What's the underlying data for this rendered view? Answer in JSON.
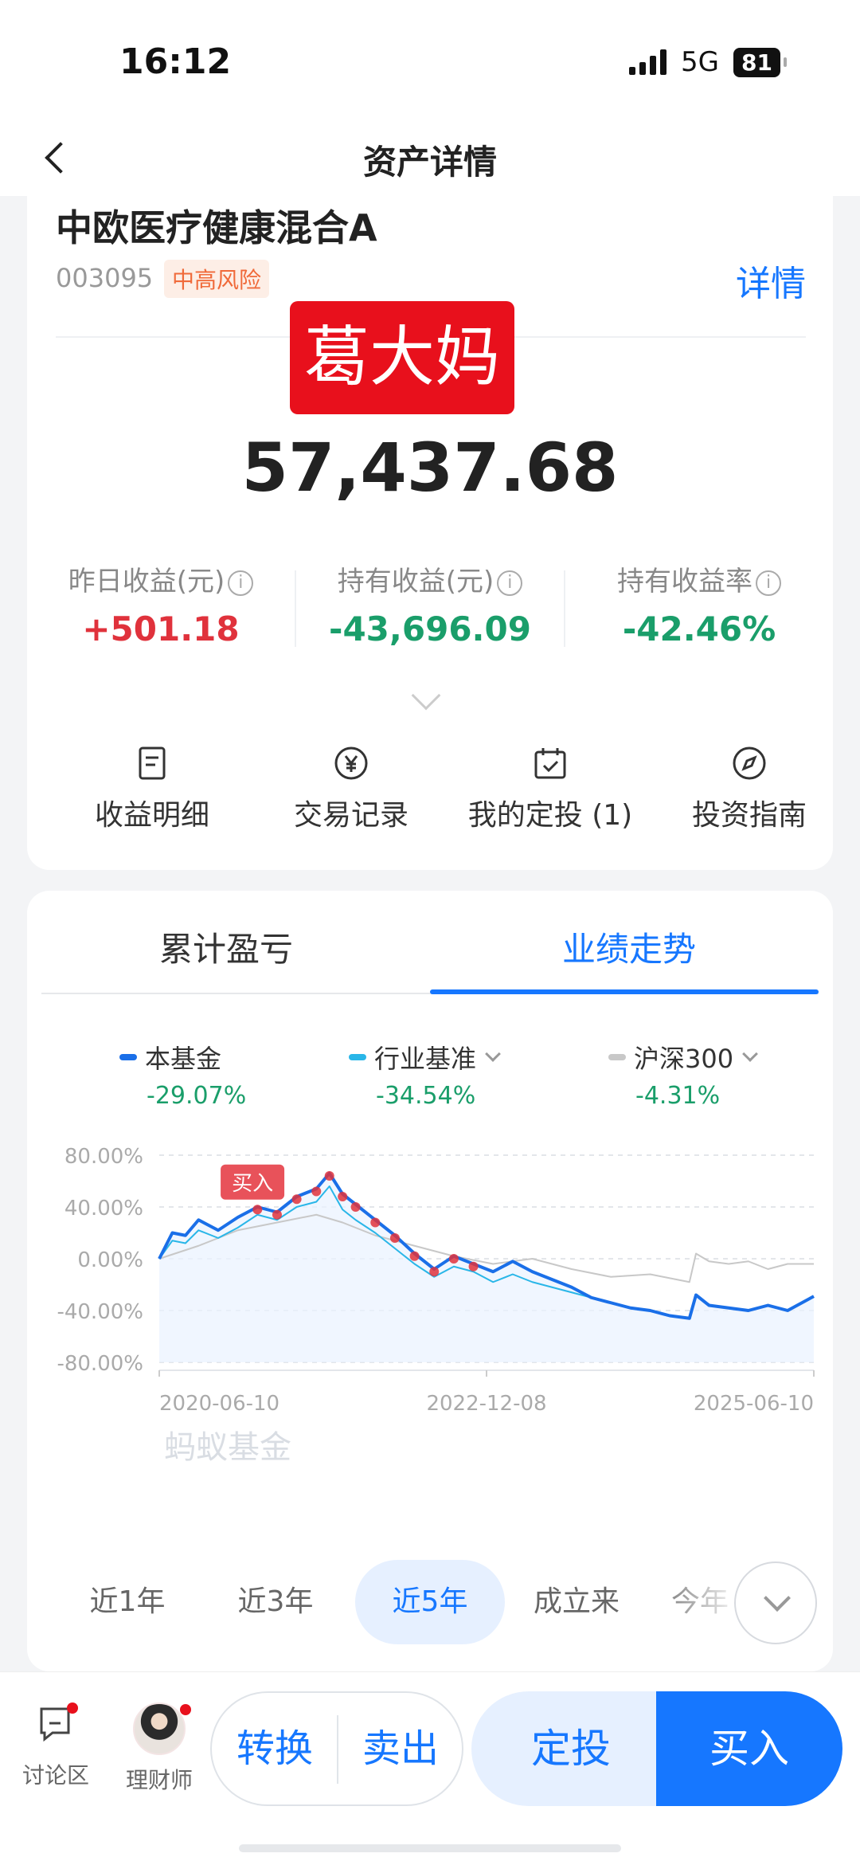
{
  "status": {
    "time": "16:12",
    "network": "5G",
    "battery": "81"
  },
  "nav": {
    "title": "资产详情"
  },
  "fund": {
    "name": "中欧医疗健康混合A",
    "code": "003095",
    "risk": "中高风险",
    "detail_link": "详情",
    "stamp": "葛大妈",
    "total_value": "57,437.68",
    "stats": [
      {
        "label": "昨日收益(元)",
        "value": "+501.18",
        "tone": "red"
      },
      {
        "label": "持有收益(元)",
        "value": "-43,696.09",
        "tone": "green"
      },
      {
        "label": "持有收益率",
        "value": "-42.46%",
        "tone": "green"
      }
    ],
    "quick_actions": [
      {
        "label": "收益明细",
        "icon": "document-icon"
      },
      {
        "label": "交易记录",
        "icon": "yen-circle-icon"
      },
      {
        "label": "我的定投 (1)",
        "icon": "calendar-check-icon"
      },
      {
        "label": "投资指南",
        "icon": "compass-icon"
      }
    ]
  },
  "perf": {
    "tabs": [
      "累计盈亏",
      "业绩走势"
    ],
    "active_tab": "业绩走势",
    "legend": [
      {
        "name": "本基金",
        "value": "-29.07%",
        "color": "#1a6fe8"
      },
      {
        "name": "行业基准",
        "value": "-34.54%",
        "color": "#29b6e8"
      },
      {
        "name": "沪深300",
        "value": "-4.31%",
        "color": "#c8c8c8"
      }
    ],
    "watermark": "蚂蚁基金",
    "periods": [
      "近1年",
      "近3年",
      "近5年",
      "成立来",
      "今年"
    ],
    "active_period": "近5年"
  },
  "chart_data": {
    "type": "line",
    "x_ticks": [
      "2020-06-10",
      "2022-12-08",
      "2025-06-10"
    ],
    "y_ticks": [
      "80.00%",
      "40.00%",
      "0.00%",
      "-40.00%",
      "-80.00%"
    ],
    "ylim": [
      -80,
      80
    ],
    "buy_marker": "买入",
    "series": [
      {
        "name": "本基金",
        "color": "#1a6fe8",
        "points": [
          [
            0,
            0
          ],
          [
            2,
            20
          ],
          [
            4,
            18
          ],
          [
            6,
            30
          ],
          [
            9,
            22
          ],
          [
            12,
            32
          ],
          [
            15,
            40
          ],
          [
            18,
            36
          ],
          [
            21,
            48
          ],
          [
            24,
            54
          ],
          [
            26,
            66
          ],
          [
            28,
            50
          ],
          [
            30,
            42
          ],
          [
            33,
            30
          ],
          [
            36,
            18
          ],
          [
            39,
            4
          ],
          [
            42,
            -8
          ],
          [
            45,
            2
          ],
          [
            48,
            -4
          ],
          [
            51,
            -10
          ],
          [
            54,
            -2
          ],
          [
            57,
            -10
          ],
          [
            60,
            -16
          ],
          [
            63,
            -22
          ],
          [
            66,
            -30
          ],
          [
            69,
            -34
          ],
          [
            72,
            -38
          ],
          [
            75,
            -40
          ],
          [
            78,
            -44
          ],
          [
            81,
            -46
          ],
          [
            82,
            -28
          ],
          [
            84,
            -36
          ],
          [
            87,
            -38
          ],
          [
            90,
            -40
          ],
          [
            93,
            -36
          ],
          [
            96,
            -40
          ],
          [
            100,
            -29
          ]
        ]
      },
      {
        "name": "行业基准",
        "color": "#29b6e8",
        "points": [
          [
            0,
            0
          ],
          [
            2,
            14
          ],
          [
            4,
            12
          ],
          [
            6,
            22
          ],
          [
            9,
            16
          ],
          [
            12,
            24
          ],
          [
            15,
            34
          ],
          [
            18,
            30
          ],
          [
            21,
            40
          ],
          [
            24,
            44
          ],
          [
            26,
            56
          ],
          [
            28,
            38
          ],
          [
            30,
            30
          ],
          [
            33,
            20
          ],
          [
            36,
            8
          ],
          [
            39,
            -4
          ],
          [
            42,
            -14
          ],
          [
            45,
            -6
          ],
          [
            48,
            -10
          ],
          [
            51,
            -18
          ],
          [
            54,
            -12
          ],
          [
            57,
            -18
          ],
          [
            60,
            -22
          ],
          [
            63,
            -26
          ],
          [
            66,
            -30
          ],
          [
            69,
            -34
          ]
        ]
      },
      {
        "name": "沪深300",
        "color": "#c8c8c8",
        "points": [
          [
            0,
            0
          ],
          [
            6,
            10
          ],
          [
            12,
            22
          ],
          [
            18,
            28
          ],
          [
            24,
            34
          ],
          [
            28,
            28
          ],
          [
            33,
            18
          ],
          [
            39,
            10
          ],
          [
            45,
            2
          ],
          [
            51,
            -4
          ],
          [
            57,
            0
          ],
          [
            63,
            -8
          ],
          [
            69,
            -14
          ],
          [
            75,
            -12
          ],
          [
            81,
            -18
          ],
          [
            82,
            4
          ],
          [
            84,
            -2
          ],
          [
            87,
            -4
          ],
          [
            90,
            -2
          ],
          [
            93,
            -8
          ],
          [
            96,
            -4
          ],
          [
            100,
            -4
          ]
        ]
      }
    ]
  },
  "bottom": {
    "forum": "讨论区",
    "advisor": "理财师",
    "convert": "转换",
    "sell": "卖出",
    "auto_invest": "定投",
    "buy": "买入"
  }
}
